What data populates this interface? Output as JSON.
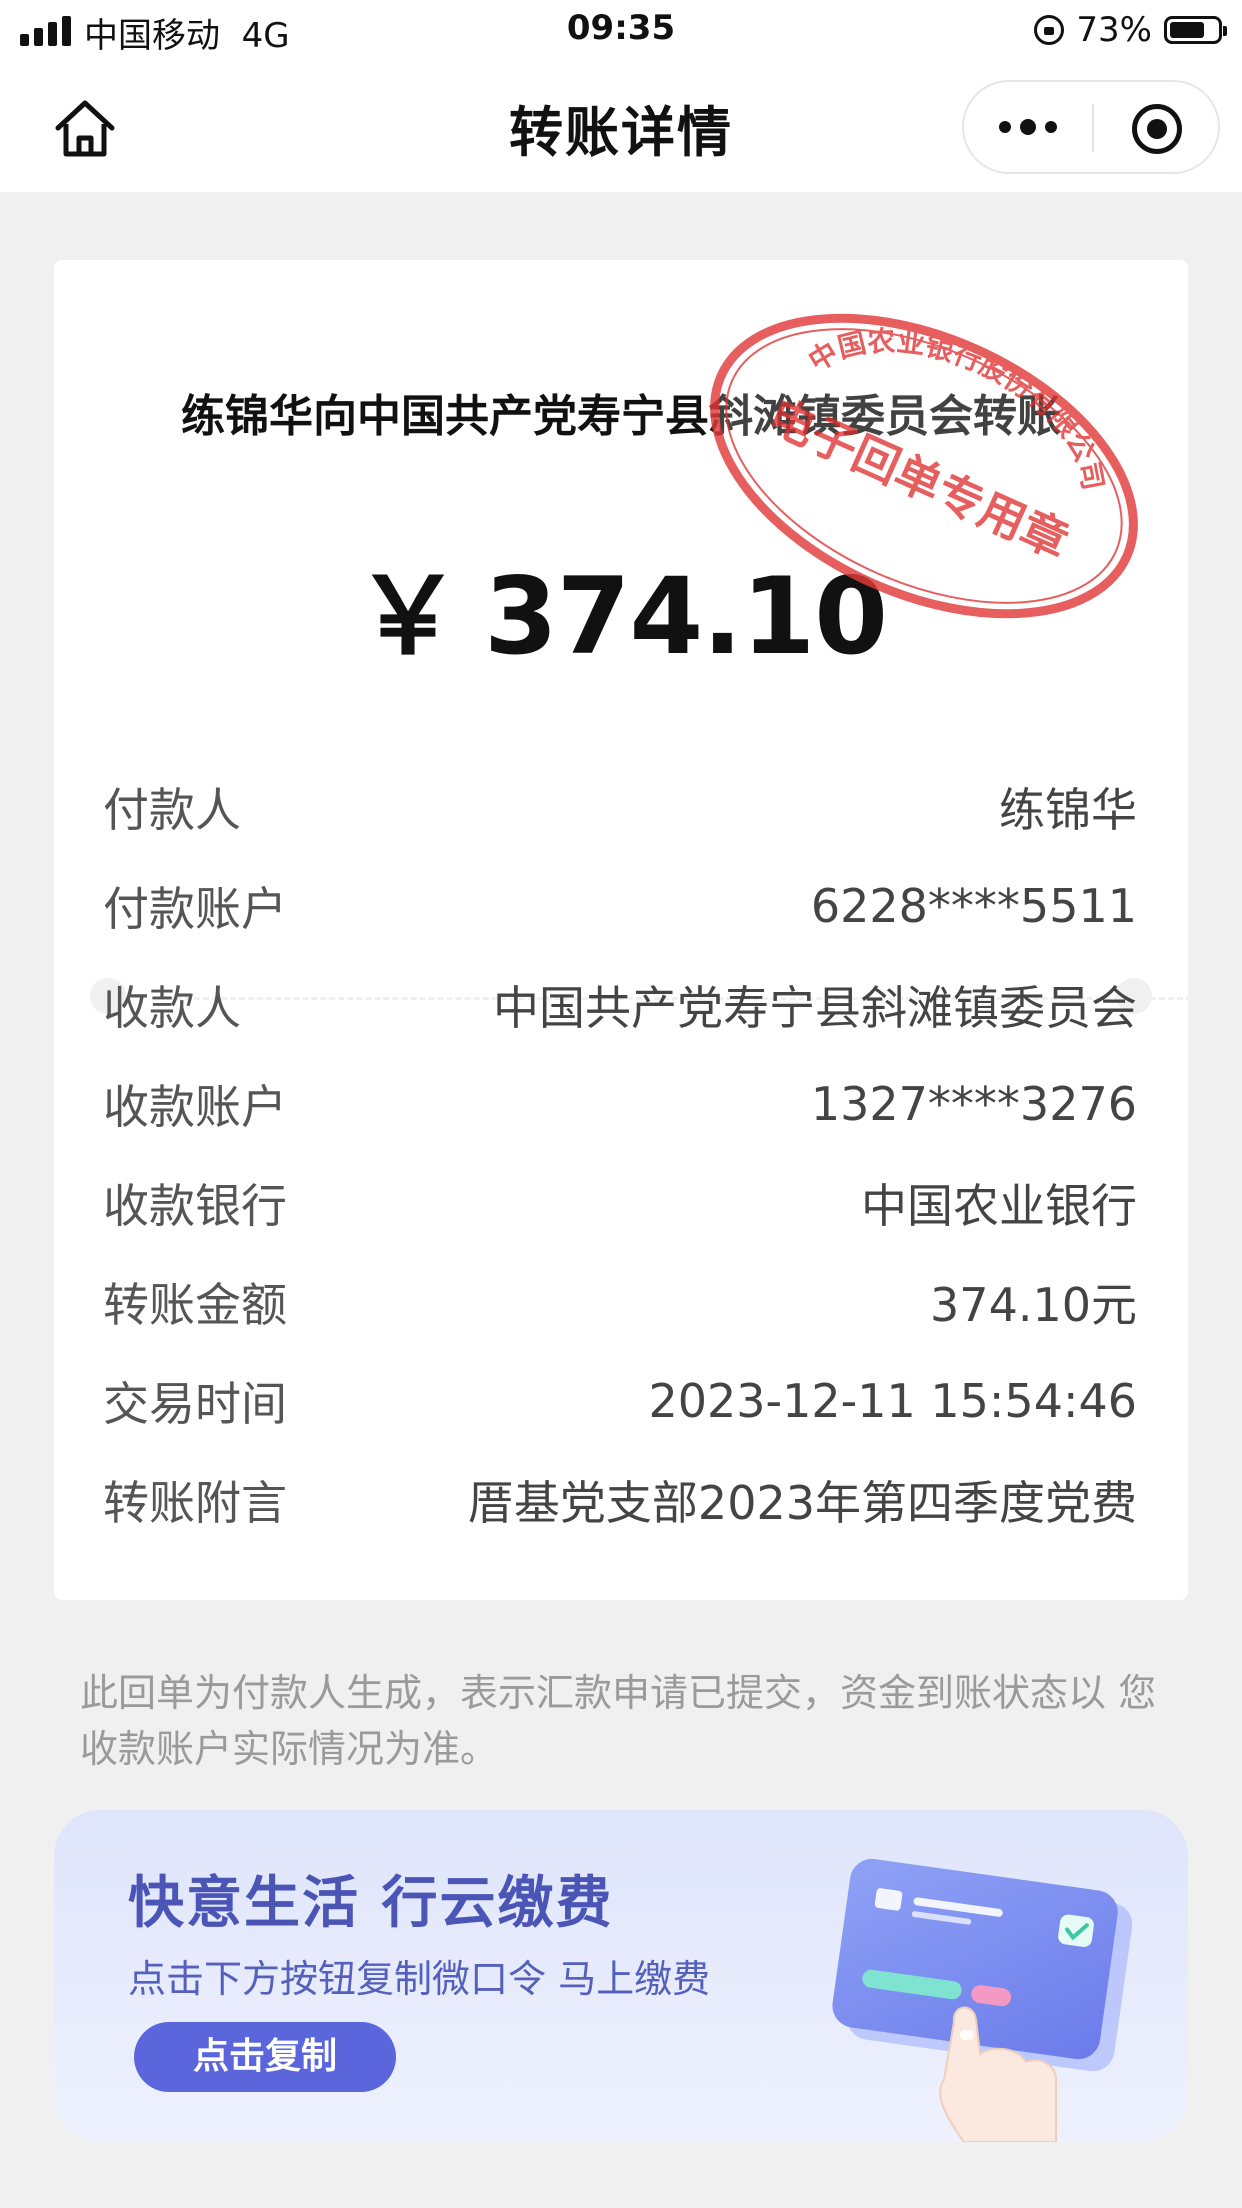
{
  "status_bar": {
    "carrier": "中国移动",
    "network": "4G",
    "time": "09:35",
    "battery_percent": "73%",
    "battery_level": 0.73
  },
  "nav": {
    "title": "转账详情",
    "home_icon": "home-icon",
    "more_icon": "more-dots-icon",
    "close_icon": "miniprogram-close-icon"
  },
  "receipt": {
    "title": "练锦华向中国共产党寿宁县斜滩镇委员会转账",
    "currency_symbol": "￥",
    "amount": "374.10",
    "stamp": {
      "outer_text": "中国农业银行股份有限公司",
      "inner_text": "电子回单专用章",
      "color": "#e43d3d"
    },
    "rows": [
      {
        "label": "付款人",
        "value": "练锦华"
      },
      {
        "label": "付款账户",
        "value": "6228****5511"
      },
      {
        "label": "收款人",
        "value": "中国共产党寿宁县斜滩镇委员会"
      },
      {
        "label": "收款账户",
        "value": "1327****3276"
      },
      {
        "label": "收款银行",
        "value": "中国农业银行"
      },
      {
        "label": "转账金额",
        "value": "374.10元"
      },
      {
        "label": "交易时间",
        "value": "2023-12-11 15:54:46"
      },
      {
        "label": "转账附言",
        "value": "厝基党支部2023年第四季度党费"
      }
    ]
  },
  "note": "此回单为付款人生成，表示汇款申请已提交，资金到账状态以 您收款账户实际情况为准。",
  "banner": {
    "title": "快意生活 行云缴费",
    "subtitle": "点击下方按钮复制微口令 马上缴费",
    "button_label": "点击复制",
    "accent_color": "#5b66dd"
  }
}
